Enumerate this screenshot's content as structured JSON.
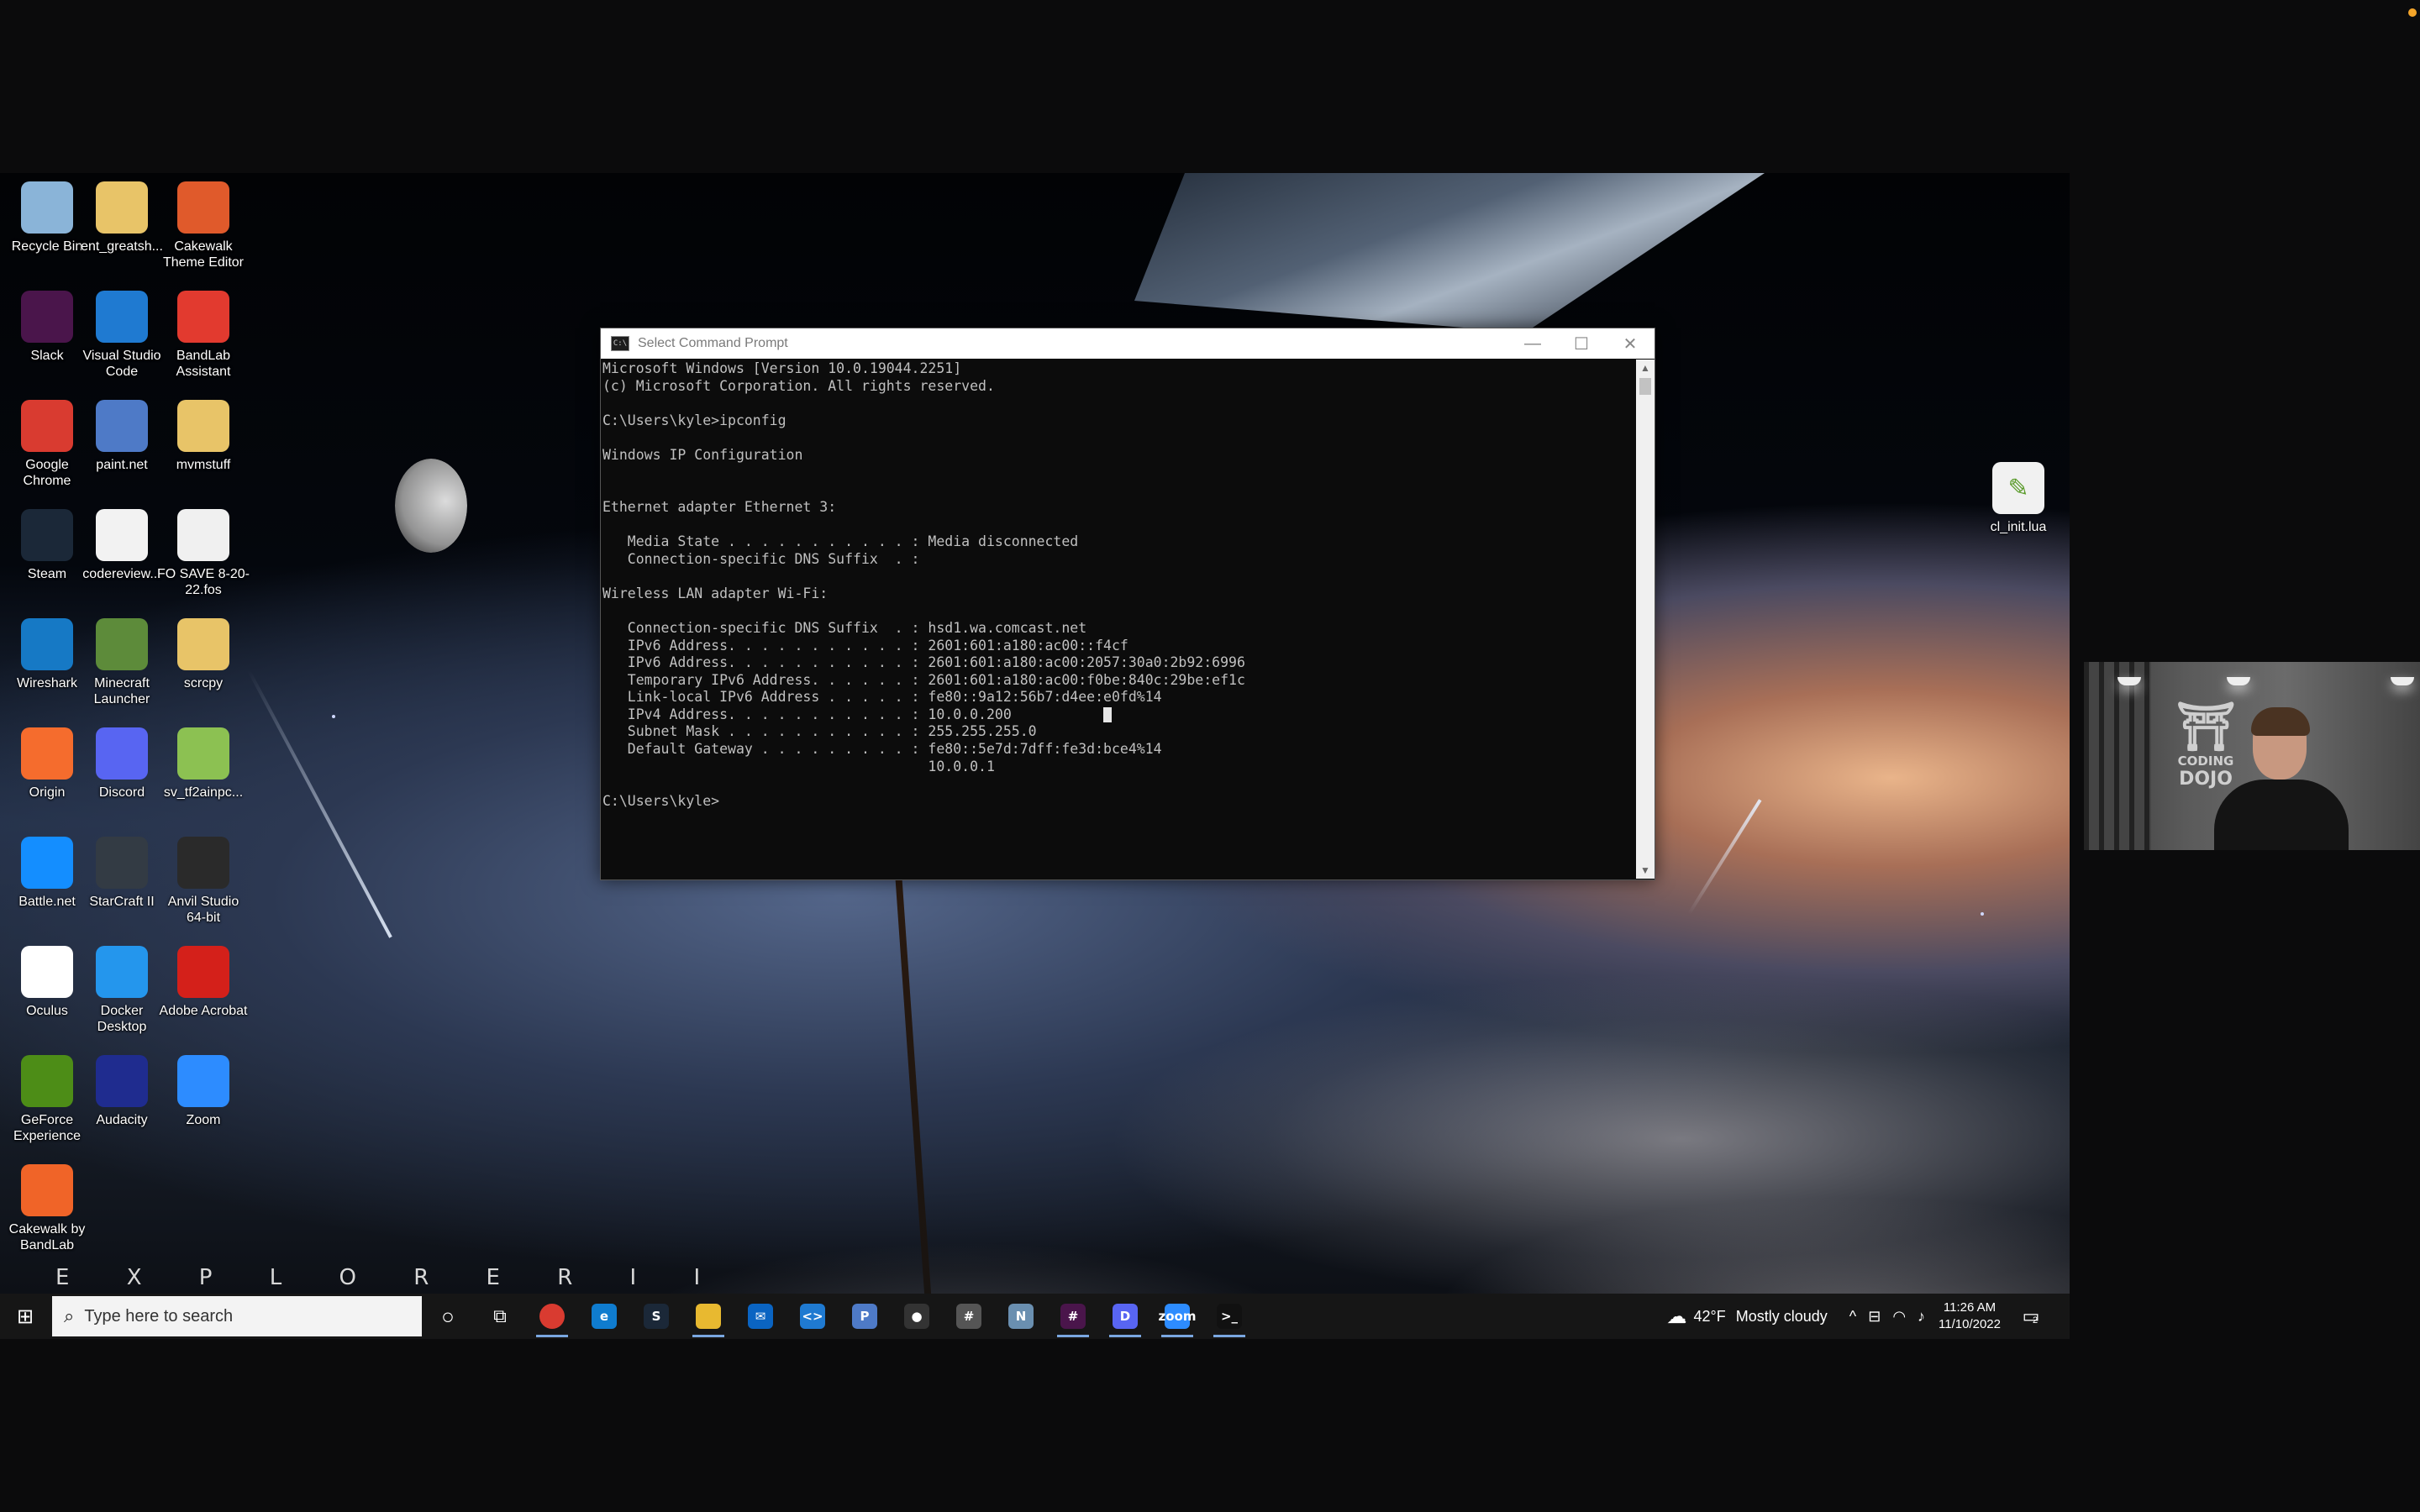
{
  "desktop_icons": [
    {
      "label": "Recycle Bin",
      "icon": "recycle-bin-icon",
      "color": "#8ab4d8"
    },
    {
      "label": "ent_greatsh...",
      "icon": "folder-icon",
      "color": "#e8c468"
    },
    {
      "label": "Cakewalk Theme Editor",
      "icon": "cakewalk-theme-editor-icon",
      "color": "#e05a2b"
    },
    {
      "label": "Slack",
      "icon": "slack-icon",
      "color": "#4a154b"
    },
    {
      "label": "Visual Studio Code",
      "icon": "vscode-icon",
      "color": "#1f7ad1"
    },
    {
      "label": "BandLab Assistant",
      "icon": "bandlab-icon",
      "color": "#e23a2f"
    },
    {
      "label": "Google Chrome",
      "icon": "chrome-icon",
      "color": "#d93b30"
    },
    {
      "label": "paint.net",
      "icon": "paint-net-icon",
      "color": "#4e7ac7"
    },
    {
      "label": "mvmstuff",
      "icon": "folder-icon",
      "color": "#e8c468"
    },
    {
      "label": "Steam",
      "icon": "steam-icon",
      "color": "#1b2838"
    },
    {
      "label": "codereview...",
      "icon": "document-icon",
      "color": "#f2f2f2"
    },
    {
      "label": "FO SAVE 8-20-22.fos",
      "icon": "fo-save-icon",
      "color": "#f0f0f0"
    },
    {
      "label": "Wireshark",
      "icon": "wireshark-icon",
      "color": "#1679c5"
    },
    {
      "label": "Minecraft Launcher",
      "icon": "minecraft-icon",
      "color": "#5d8b3a"
    },
    {
      "label": "scrcpy",
      "icon": "folder-icon",
      "color": "#e8c468"
    },
    {
      "label": "Origin",
      "icon": "origin-icon",
      "color": "#f56c2d"
    },
    {
      "label": "Discord",
      "icon": "discord-icon",
      "color": "#5865f2"
    },
    {
      "label": "sv_tf2ainpc...",
      "icon": "notepadpp-file-icon",
      "color": "#8cc152"
    },
    {
      "label": "Battle.net",
      "icon": "battle-net-icon",
      "color": "#148eff"
    },
    {
      "label": "StarCraft II",
      "icon": "starcraft-icon",
      "color": "#333b44"
    },
    {
      "label": "Anvil Studio 64-bit",
      "icon": "anvil-studio-icon",
      "color": "#2a2a2a"
    },
    {
      "label": "Oculus",
      "icon": "oculus-icon",
      "color": "#ffffff"
    },
    {
      "label": "Docker Desktop",
      "icon": "docker-icon",
      "color": "#2496ed"
    },
    {
      "label": "Adobe Acrobat",
      "icon": "acrobat-icon",
      "color": "#d4201a"
    },
    {
      "label": "GeForce Experience",
      "icon": "geforce-icon",
      "color": "#4d8d17"
    },
    {
      "label": "Audacity",
      "icon": "audacity-icon",
      "color": "#1f2c8f"
    },
    {
      "label": "Zoom",
      "icon": "zoom-icon",
      "color": "#2d8cff"
    },
    {
      "label": "Cakewalk by BandLab",
      "icon": "cakewalk-icon",
      "color": "#f06428"
    }
  ],
  "right_icon": {
    "label": "cl_init.lua",
    "icon": "lua-file-icon"
  },
  "wallpaper": {
    "logo_text": "E X P L O R E R   I I"
  },
  "cmd": {
    "title": "Select Command Prompt",
    "output": "Microsoft Windows [Version 10.0.19044.2251]\n(c) Microsoft Corporation. All rights reserved.\n\nC:\\Users\\kyle>ipconfig\n\nWindows IP Configuration\n\n\nEthernet adapter Ethernet 3:\n\n   Media State . . . . . . . . . . . : Media disconnected\n   Connection-specific DNS Suffix  . :\n\nWireless LAN adapter Wi-Fi:\n\n   Connection-specific DNS Suffix  . : hsd1.wa.comcast.net\n   IPv6 Address. . . . . . . . . . . : 2601:601:a180:ac00::f4cf\n   IPv6 Address. . . . . . . . . . . : 2601:601:a180:ac00:2057:30a0:2b92:6996\n   Temporary IPv6 Address. . . . . . : 2601:601:a180:ac00:f0be:840c:29be:ef1c\n   Link-local IPv6 Address . . . . . : fe80::9a12:56b7:d4ee:e0fd%14\n   IPv4 Address. . . . . . . . . . . : 10.0.0.200\n   Subnet Mask . . . . . . . . . . . : 255.255.255.0\n   Default Gateway . . . . . . . . . : fe80::5e7d:7dff:fe3d:bce4%14\n                                       10.0.0.1\n\nC:\\Users\\kyle>"
  },
  "taskbar": {
    "search_placeholder": "Type here to search",
    "apps": [
      {
        "name": "chrome",
        "glyph": "",
        "color": "#d93b30",
        "active": true
      },
      {
        "name": "edge",
        "glyph": "e",
        "color": "#0f7ccf",
        "active": false
      },
      {
        "name": "steam",
        "glyph": "S",
        "color": "#1b2838",
        "active": false
      },
      {
        "name": "file-explorer",
        "glyph": "",
        "color": "#e8b930",
        "active": true
      },
      {
        "name": "mail",
        "glyph": "✉",
        "color": "#0a64c2",
        "active": false
      },
      {
        "name": "vscode",
        "glyph": "<>",
        "color": "#1f7ad1",
        "active": false
      },
      {
        "name": "paint-net",
        "glyph": "P",
        "color": "#4e7ac7",
        "active": false
      },
      {
        "name": "app",
        "glyph": "●",
        "color": "#333",
        "active": false
      },
      {
        "name": "calculator",
        "glyph": "#",
        "color": "#555",
        "active": false
      },
      {
        "name": "notepad",
        "glyph": "N",
        "color": "#6a8fb0",
        "active": false
      },
      {
        "name": "slack",
        "glyph": "#",
        "color": "#4a154b",
        "active": true
      },
      {
        "name": "discord",
        "glyph": "D",
        "color": "#5865f2",
        "active": true
      },
      {
        "name": "zoom",
        "glyph": "zoom",
        "color": "#2d8cff",
        "active": true
      },
      {
        "name": "command-prompt",
        "glyph": ">_",
        "color": "#111",
        "active": true
      }
    ],
    "weather_temp": "42°F",
    "weather_desc": "Mostly cloudy",
    "time": "11:26 AM",
    "date": "11/10/2022",
    "notification_count": "2"
  },
  "webcam": {
    "sign_line1": "CODING",
    "sign_line2": "DOJO"
  }
}
